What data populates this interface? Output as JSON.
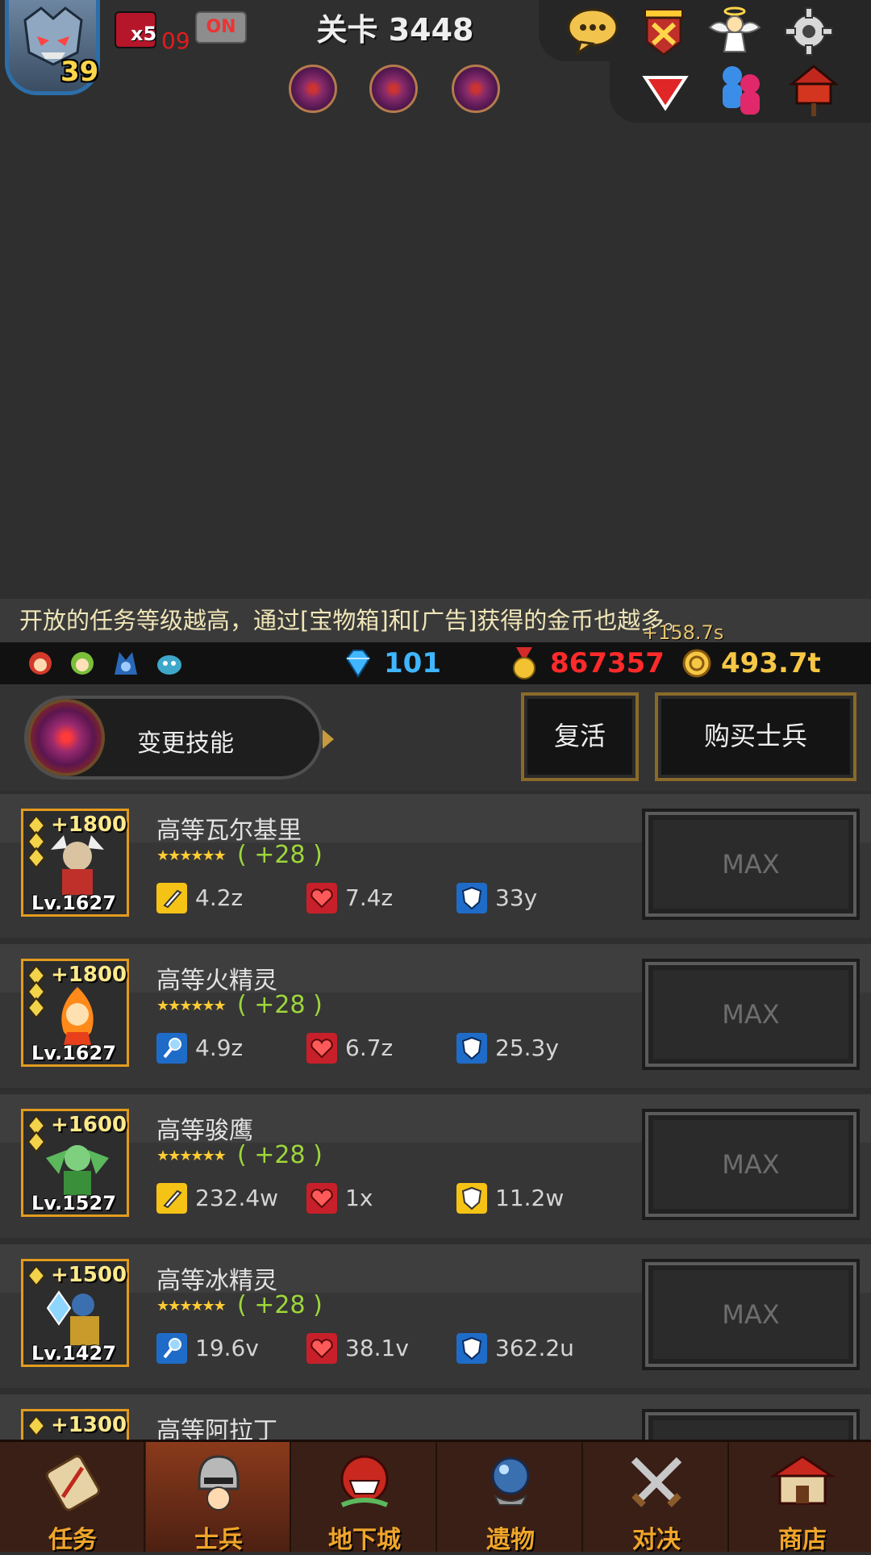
{
  "hud": {
    "player_level": "39",
    "boost_multiplier": "x5",
    "boost_timer": "09",
    "toggle_label": "ON",
    "stage_title": "关卡 3448",
    "skill_slots": [
      "skill-orb",
      "skill-orb",
      "skill-orb"
    ],
    "icons": [
      "chat-icon",
      "castle-shield-icon",
      "angel-icon",
      "gear-icon",
      "dropdown-arrow-icon",
      "friends-icon",
      "mailbox-icon"
    ]
  },
  "notice": {
    "text": "开放的任务等级越高，通过[宝物箱]和[广告]获得的金币也越多。",
    "floating_gain": "+158.7s"
  },
  "currency": {
    "gems": "101",
    "medals": "867357",
    "gold": "493.7t",
    "gem_color": "#3fb6ff",
    "medal_color": "#ff2a2a",
    "gold_color": "#f6c744"
  },
  "actions": {
    "change_skill": "变更技能",
    "revive": "复活",
    "buy_soldier": "购买士兵"
  },
  "soldiers": [
    {
      "name": "高等瓦尔基里",
      "plus": "+1800",
      "level": "Lv.1627",
      "bonus": "( +28 )",
      "attack": "4.2z",
      "hp": "7.4z",
      "defense": "33y",
      "button": "MAX"
    },
    {
      "name": "高等火精灵",
      "plus": "+1800",
      "level": "Lv.1627",
      "bonus": "( +28 )",
      "attack": "4.9z",
      "hp": "6.7z",
      "defense": "25.3y",
      "button": "MAX"
    },
    {
      "name": "高等骏鹰",
      "plus": "+1600",
      "level": "Lv.1527",
      "bonus": "( +28 )",
      "attack": "232.4w",
      "hp": "1x",
      "defense": "11.2w",
      "button": "MAX"
    },
    {
      "name": "高等冰精灵",
      "plus": "+1500",
      "level": "Lv.1427",
      "bonus": "( +28 )",
      "attack": "19.6v",
      "hp": "38.1v",
      "defense": "362.2u",
      "button": "MAX"
    },
    {
      "name": "高等阿拉丁",
      "plus": "+1300",
      "level": "",
      "bonus": "",
      "attack": "",
      "hp": "",
      "defense": "",
      "button": ""
    }
  ],
  "stars": "★★★★★★",
  "nav": [
    {
      "label": "任务"
    },
    {
      "label": "士兵"
    },
    {
      "label": "地下城"
    },
    {
      "label": "遗物"
    },
    {
      "label": "对决"
    },
    {
      "label": "商店"
    }
  ]
}
